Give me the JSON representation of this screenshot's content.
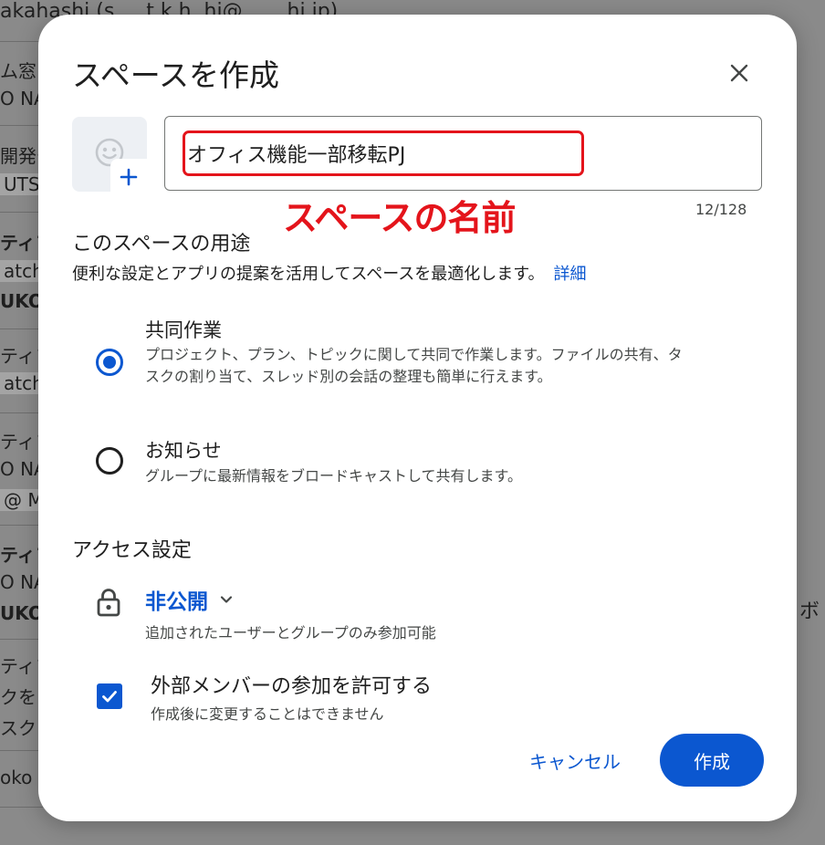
{
  "background": {
    "top_text": "akahashi (s.....t.k.h..hi@.......hi.jp)",
    "list_fragments": [
      {
        "text": "ム窓口",
        "bold": false,
        "hl": false
      },
      {
        "text": "O NAC",
        "bold": false,
        "hl": false
      },
      {
        "text": "開発チ",
        "bold": false,
        "hl": false
      },
      {
        "text": "UTS",
        "bold": false,
        "hl": true
      },
      {
        "text": "ティフ",
        "bold": true,
        "hl": false
      },
      {
        "text": "atchm",
        "bold": false,
        "hl": true
      },
      {
        "text": "UKO",
        "bold": true,
        "hl": false
      },
      {
        "text": "ティフ",
        "bold": false,
        "hl": false
      },
      {
        "text": "atchm",
        "bold": false,
        "hl": true
      },
      {
        "text": "ティフ",
        "bold": false,
        "hl": false
      },
      {
        "text": "O NAC",
        "bold": false,
        "hl": false
      },
      {
        "text": "@ MU",
        "bold": false,
        "hl": true
      },
      {
        "text": "ティフ",
        "bold": true,
        "hl": false
      },
      {
        "text": "O NAC",
        "bold": false,
        "hl": false
      },
      {
        "text": "UKO",
        "bold": true,
        "hl": false
      },
      {
        "text": "ティフ",
        "bold": false,
        "hl": false
      },
      {
        "text": "クを",
        "bold": false,
        "hl": false
      },
      {
        "text": "スク",
        "bold": false,
        "hl": false
      },
      {
        "text": "oko",
        "bold": false,
        "hl": false
      }
    ],
    "right_fragment": "ボ"
  },
  "dialog": {
    "title": "スペースを作成",
    "close_icon": "close-icon",
    "avatar_icons": [
      "emoji-smile-icon",
      "plus-icon"
    ],
    "space_name": {
      "value": "オフィス機能一部移転PJ",
      "counter": "12/128"
    },
    "annotation_label": "スペースの名前",
    "purpose": {
      "title": "このスペースの用途",
      "description": "便利な設定とアプリの提案を活用してスペースを最適化します。",
      "detail_link": "詳細",
      "options": [
        {
          "title": "共同作業",
          "description": "プロジェクト、プラン、トピックに関して共同で作業します。ファイルの共有、タスクの割り当て、スレッド別の会話の整理も簡単に行えます。",
          "checked": true
        },
        {
          "title": "お知らせ",
          "description": "グループに最新情報をブロードキャストして共有します。",
          "checked": false
        }
      ]
    },
    "access": {
      "title": "アクセス設定",
      "value": "非公開",
      "description": "追加されたユーザーとグループのみ参加可能",
      "icon": "lock-icon"
    },
    "external": {
      "title": "外部メンバーの参加を許可する",
      "description": "作成後に変更することはできません",
      "checked": true
    },
    "buttons": {
      "cancel": "キャンセル",
      "create": "作成"
    },
    "colors": {
      "primary": "#0b57d0",
      "annotation": "#e4141b",
      "text": "#1f1f1f",
      "secondary_text": "#444746"
    }
  }
}
